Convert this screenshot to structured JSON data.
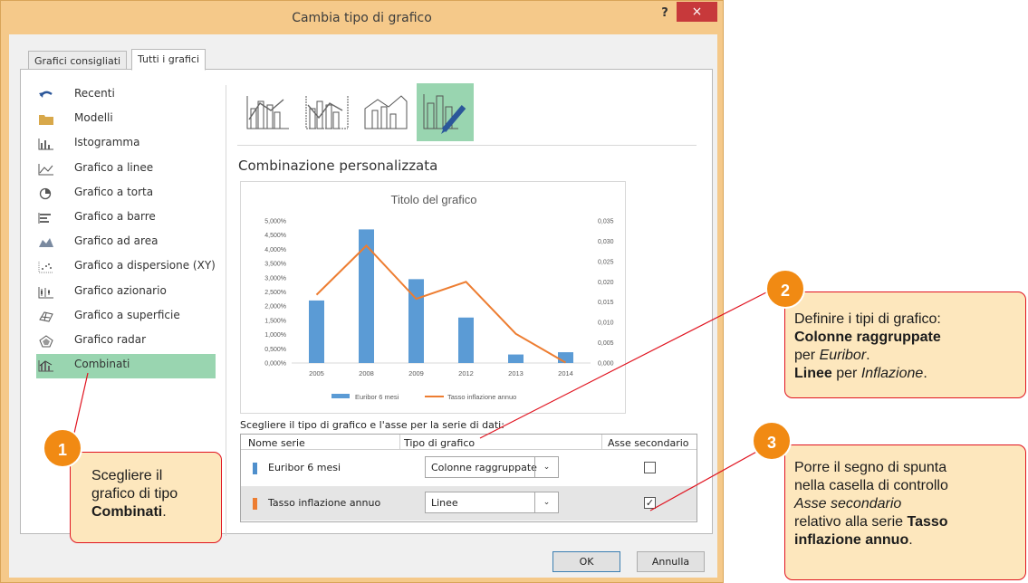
{
  "window": {
    "title": "Cambia tipo di grafico",
    "help": "?",
    "close": "×"
  },
  "tabs": [
    {
      "label": "Grafici consigliati",
      "active": false
    },
    {
      "label": "Tutti i grafici",
      "active": true
    }
  ],
  "chart_types": [
    {
      "label": "Recenti",
      "icon": "undo-icon"
    },
    {
      "label": "Modelli",
      "icon": "folder-icon"
    },
    {
      "label": "Istogramma",
      "icon": "column-chart-icon"
    },
    {
      "label": "Grafico a linee",
      "icon": "line-chart-icon"
    },
    {
      "label": "Grafico a torta",
      "icon": "pie-chart-icon"
    },
    {
      "label": "Grafico a barre",
      "icon": "bar-chart-icon"
    },
    {
      "label": "Grafico ad area",
      "icon": "area-chart-icon"
    },
    {
      "label": "Grafico a dispersione (XY)",
      "icon": "scatter-chart-icon"
    },
    {
      "label": "Grafico azionario",
      "icon": "stock-chart-icon"
    },
    {
      "label": "Grafico a superficie",
      "icon": "surface-chart-icon"
    },
    {
      "label": "Grafico radar",
      "icon": "radar-chart-icon"
    },
    {
      "label": "Combinati",
      "icon": "combo-chart-icon",
      "selected": true
    }
  ],
  "combo_section_title": "Combinazione personalizzata",
  "chart_data": {
    "type": "bar",
    "title": "Titolo del grafico",
    "categories": [
      "2005",
      "2008",
      "2009",
      "2012",
      "2013",
      "2014"
    ],
    "y_ticks_primary": [
      "5,000%",
      "4,500%",
      "4,000%",
      "3,500%",
      "3,000%",
      "2,500%",
      "2,000%",
      "1,500%",
      "1,000%",
      "0,500%",
      "0,000%"
    ],
    "y_ticks_secondary": [
      "0,035",
      "0,030",
      "0,025",
      "0,020",
      "0,015",
      "0,010",
      "0,005",
      "0,000"
    ],
    "ylim": [
      0,
      5
    ],
    "ylim_secondary": [
      0,
      0.035
    ],
    "series": [
      {
        "name": "Euribor 6 mesi",
        "kind": "bar",
        "axis": "primary",
        "color": "#5b9bd5",
        "values": [
          2.2,
          4.7,
          2.95,
          1.6,
          0.3,
          0.38
        ]
      },
      {
        "name": "Tasso inflazione annuo",
        "kind": "line",
        "axis": "secondary",
        "color": "#ed7d31",
        "values": [
          0.0168,
          0.0289,
          0.0158,
          0.02,
          0.0072,
          0.0001
        ]
      }
    ],
    "legend_position": "bottom",
    "grid": false
  },
  "series_section": {
    "caption": "Scegliere il tipo di grafico e l'asse per la serie di dati:",
    "headers": {
      "name": "Nome serie",
      "type": "Tipo di grafico",
      "secondary": "Asse secondario"
    },
    "rows": [
      {
        "name": "Euribor 6 mesi",
        "type": "Colonne raggruppate",
        "secondary": false,
        "color": "#5b9bd5"
      },
      {
        "name": "Tasso inflazione annuo",
        "type": "Linee",
        "secondary": true,
        "color": "#ed7d31"
      }
    ]
  },
  "buttons": {
    "ok": "OK",
    "cancel": "Annulla"
  },
  "callouts": {
    "c1": {
      "number": "1",
      "line1": "Scegliere il",
      "line2": "grafico di tipo",
      "bold": "Combinati",
      "end": "."
    },
    "c2": {
      "number": "2",
      "line1": "Definire i tipi di grafico:",
      "bold1": "Colonne raggruppate",
      "per1": "per ",
      "ital1": "Euribor",
      "dot1": ".",
      "bold2": "Linee",
      "per2": " per ",
      "ital2": "Inflazione",
      "dot2": "."
    },
    "c3": {
      "number": "3",
      "line1": "Porre il segno di spunta",
      "line2": "nella casella di controllo",
      "ital": "Asse secondario",
      "line4a": "relativo alla serie ",
      "bold1": "Tasso",
      "bold2": "inflazione annuo",
      "end": "."
    }
  },
  "colors": {
    "accent_selected": "#99d5b0",
    "callout_border": "#e0131f",
    "badge": "#f18a13",
    "callout_bg": "#fde7bd",
    "window_frame": "#f5c98a"
  }
}
